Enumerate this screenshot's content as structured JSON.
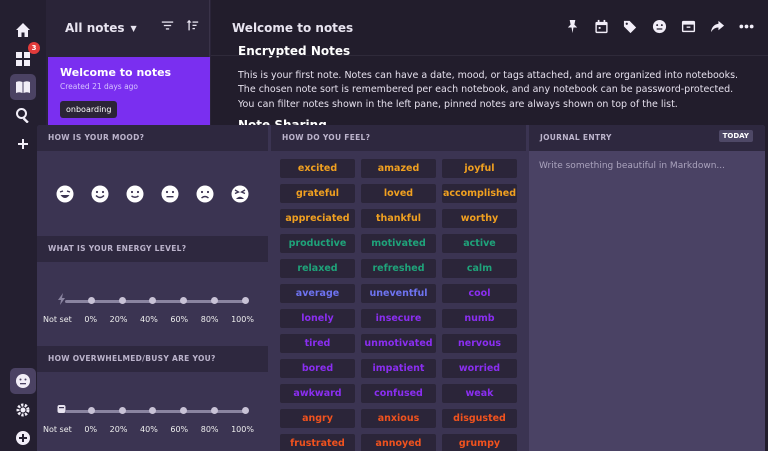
{
  "rail": {
    "badge_count": "3"
  },
  "notes": {
    "title": "All notes",
    "card": {
      "title": "Welcome to notes",
      "date": "Created 21 days ago",
      "tag": "onboarding"
    }
  },
  "editor": {
    "title": "Welcome to notes",
    "heading1": "Encrypted Notes",
    "paragraph": "This is your first note. Notes can have a date, mood, or tags attached, and are organized into notebooks. The chosen note sort is remembered per each notebook, and any notebook can be password-protected. You can filter notes shown in the left pane, pinned notes are always shown on top of the list.",
    "heading2": "Note Sharing"
  },
  "mood": {
    "mood_header": "HOW IS YOUR MOOD?",
    "energy_header": "WHAT IS YOUR ENERGY LEVEL?",
    "busy_header": "HOW OVERWHELMED/BUSY ARE YOU?",
    "slider_labels": [
      "Not set",
      "0%",
      "20%",
      "40%",
      "60%",
      "80%",
      "100%"
    ],
    "feel_header": "HOW DO YOU FEEL?",
    "journal_header": "JOURNAL ENTRY",
    "today_label": "TODAY",
    "journal_placeholder": "Write something beautiful in Markdown...",
    "feelings": [
      {
        "t": "excited",
        "c": "#f0a020"
      },
      {
        "t": "amazed",
        "c": "#f0a020"
      },
      {
        "t": "joyful",
        "c": "#f0a020"
      },
      {
        "t": "grateful",
        "c": "#f0a020"
      },
      {
        "t": "loved",
        "c": "#f0a020"
      },
      {
        "t": "accomplished",
        "c": "#f0a020"
      },
      {
        "t": "appreciated",
        "c": "#f0a020"
      },
      {
        "t": "thankful",
        "c": "#f0a020"
      },
      {
        "t": "worthy",
        "c": "#f0a020"
      },
      {
        "t": "productive",
        "c": "#1fa37a"
      },
      {
        "t": "motivated",
        "c": "#1fa37a"
      },
      {
        "t": "active",
        "c": "#1fa37a"
      },
      {
        "t": "relaxed",
        "c": "#1fa37a"
      },
      {
        "t": "refreshed",
        "c": "#1fa37a"
      },
      {
        "t": "calm",
        "c": "#1fa37a"
      },
      {
        "t": "average",
        "c": "#6e73f0"
      },
      {
        "t": "uneventful",
        "c": "#6e73f0"
      },
      {
        "t": "cool",
        "c": "#8a2ef0"
      },
      {
        "t": "lonely",
        "c": "#8a2ef0"
      },
      {
        "t": "insecure",
        "c": "#8a2ef0"
      },
      {
        "t": "numb",
        "c": "#8a2ef0"
      },
      {
        "t": "tired",
        "c": "#8a2ef0"
      },
      {
        "t": "unmotivated",
        "c": "#8a2ef0"
      },
      {
        "t": "nervous",
        "c": "#8a2ef0"
      },
      {
        "t": "bored",
        "c": "#8a2ef0"
      },
      {
        "t": "impatient",
        "c": "#8a2ef0"
      },
      {
        "t": "worried",
        "c": "#8a2ef0"
      },
      {
        "t": "awkward",
        "c": "#8a2ef0"
      },
      {
        "t": "confused",
        "c": "#8a2ef0"
      },
      {
        "t": "weak",
        "c": "#8a2ef0"
      },
      {
        "t": "angry",
        "c": "#f0521e"
      },
      {
        "t": "anxious",
        "c": "#f0521e"
      },
      {
        "t": "disgusted",
        "c": "#f0521e"
      },
      {
        "t": "frustrated",
        "c": "#f0521e"
      },
      {
        "t": "annoyed",
        "c": "#f0521e"
      },
      {
        "t": "grumpy",
        "c": "#f0521e"
      }
    ]
  }
}
